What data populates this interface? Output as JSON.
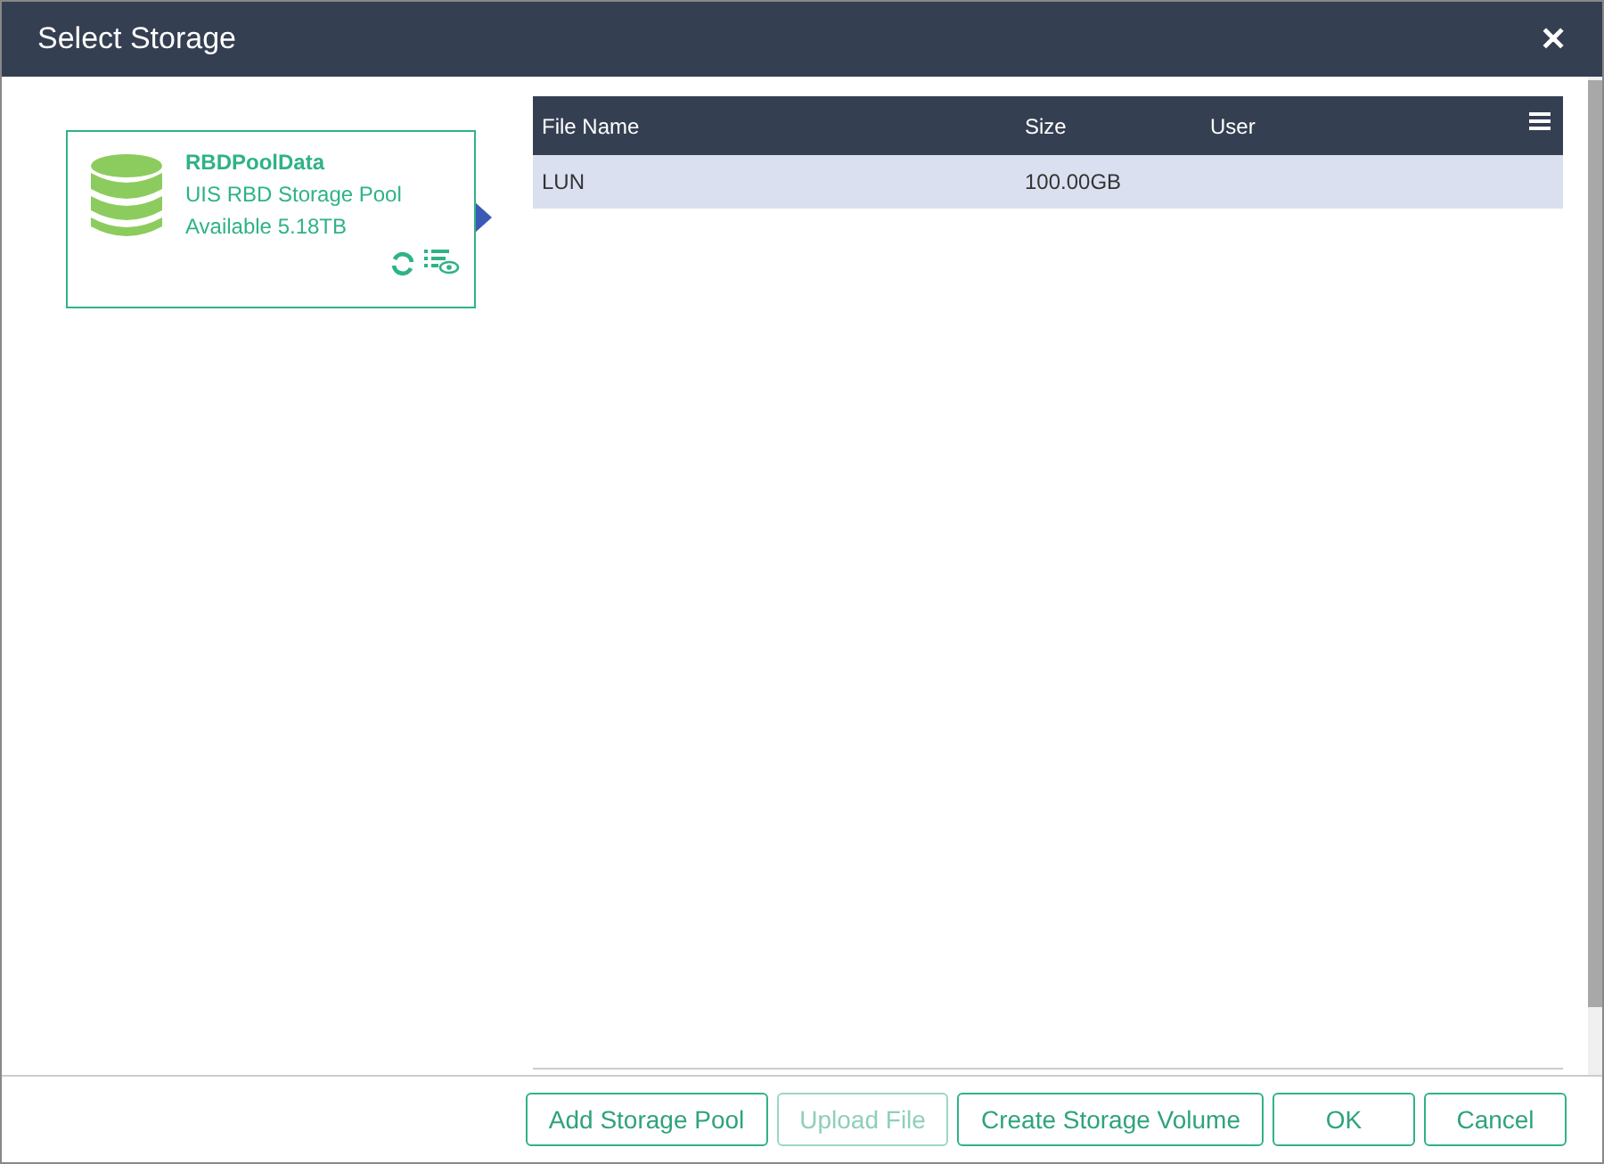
{
  "window": {
    "title": "Select Storage",
    "close": "✕"
  },
  "pools": [
    {
      "name": "RBDPoolData",
      "type": "UIS RBD Storage Pool",
      "available": "Available 5.18TB",
      "selected": true
    }
  ],
  "table": {
    "columns": [
      "File Name",
      "Size",
      "User"
    ],
    "rows": [
      {
        "cells": [
          "LUN",
          "100.00GB",
          ""
        ],
        "selected": true
      }
    ]
  },
  "buttons": [
    {
      "label": "Add Storage Pool",
      "disabled": false
    },
    {
      "label": "Upload File",
      "disabled": true
    },
    {
      "label": "Create Storage Volume",
      "disabled": false
    },
    {
      "label": "OK",
      "disabled": false
    },
    {
      "label": "Cancel",
      "disabled": false
    }
  ]
}
